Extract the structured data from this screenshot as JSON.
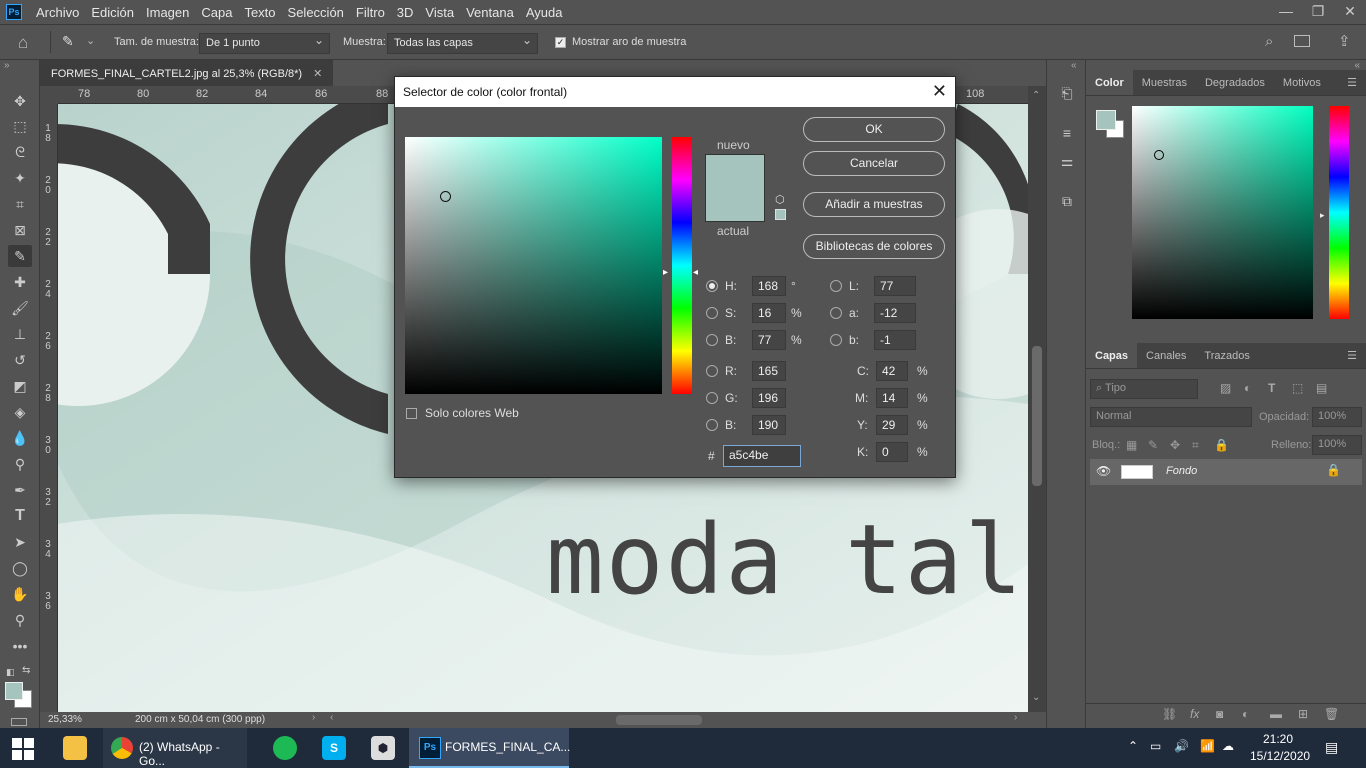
{
  "menubar": {
    "items": [
      "Archivo",
      "Edición",
      "Imagen",
      "Capa",
      "Texto",
      "Selección",
      "Filtro",
      "3D",
      "Vista",
      "Ventana",
      "Ayuda"
    ]
  },
  "options": {
    "sample_size_label": "Tam. de muestra:",
    "sample_size_value": "De 1 punto",
    "sample_label": "Muestra:",
    "sample_value": "Todas las capas",
    "show_ring_label": "Mostrar aro de muestra"
  },
  "document": {
    "tab_title": "FORMES_FINAL_CARTEL2.jpg al 25,3% (RGB/8*)",
    "ruler_h": [
      "78",
      "80",
      "82",
      "84",
      "86",
      "88",
      "108"
    ],
    "ruler_v": [
      "1\n8",
      "2\n0",
      "2\n2",
      "2\n4",
      "2\n6",
      "2\n8",
      "3\n0",
      "3\n2",
      "3\n4",
      "3\n6"
    ],
    "canvas_text": "moda tal",
    "zoom": "25,33%",
    "doc_size": "200 cm x 50,04 cm (300 ppp)"
  },
  "dialog": {
    "title": "Selector de color (color frontal)",
    "new_label": "nuevo",
    "current_label": "actual",
    "web_only_label": "Solo colores Web",
    "buttons": {
      "ok": "OK",
      "cancel": "Cancelar",
      "add_swatch": "Añadir a muestras",
      "libraries": "Bibliotecas de colores"
    },
    "hsb": [
      {
        "label": "H:",
        "value": "168",
        "unit": "°"
      },
      {
        "label": "S:",
        "value": "16",
        "unit": "%"
      },
      {
        "label": "B:",
        "value": "77",
        "unit": "%"
      }
    ],
    "rgb": [
      {
        "label": "R:",
        "value": "165"
      },
      {
        "label": "G:",
        "value": "196"
      },
      {
        "label": "B:",
        "value": "190"
      }
    ],
    "lab": [
      {
        "label": "L:",
        "value": "77"
      },
      {
        "label": "a:",
        "value": "-12"
      },
      {
        "label": "b:",
        "value": "-1"
      }
    ],
    "cmyk": [
      {
        "label": "C:",
        "value": "42",
        "unit": "%"
      },
      {
        "label": "M:",
        "value": "14",
        "unit": "%"
      },
      {
        "label": "Y:",
        "value": "29",
        "unit": "%"
      },
      {
        "label": "K:",
        "value": "0",
        "unit": "%"
      }
    ],
    "hex_label": "#",
    "hex": "a5c4be"
  },
  "panels": {
    "color_tabs": [
      "Color",
      "Muestras",
      "Degradados",
      "Motivos"
    ],
    "layer_tabs": [
      "Capas",
      "Canales",
      "Trazados"
    ],
    "kind_placeholder": "Tipo",
    "blend_mode": "Normal",
    "opacity_label": "Opacidad:",
    "opacity_value": "100%",
    "lock_label": "Bloq.:",
    "fill_label": "Relleno:",
    "fill_value": "100%",
    "layer_name": "Fondo"
  },
  "taskbar": {
    "apps": [
      {
        "label": "(2) WhatsApp - Go..."
      },
      {
        "label": "FORMES_FINAL_CA..."
      }
    ],
    "time": "21:20",
    "date": "15/12/2020"
  },
  "colors": {
    "foreground": "#a5c4be",
    "accent": "#31a8ff"
  }
}
